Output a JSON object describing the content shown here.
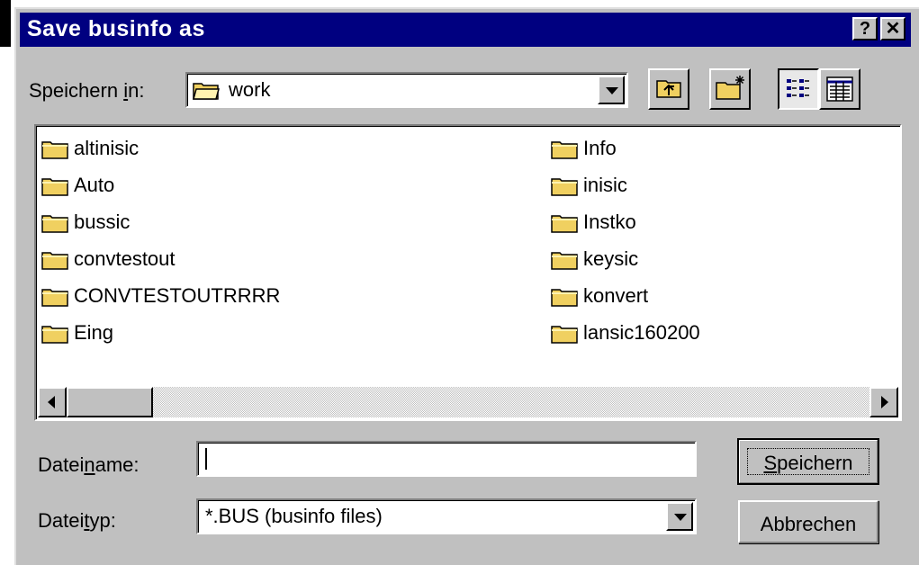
{
  "dialog": {
    "title": "Save businfo as",
    "help_btn": "?",
    "close_btn": "✕"
  },
  "location": {
    "label_pre": "Speichern ",
    "label_key": "i",
    "label_post": "n:",
    "value": "work"
  },
  "toolbar": {
    "icons": [
      "up-one-level-icon",
      "create-new-folder-icon",
      "list-view-icon",
      "details-view-icon"
    ]
  },
  "files": {
    "column1": [
      "altinisic",
      "Auto",
      "bussic",
      "convtestout",
      "CONVTESTOUTRRRR",
      "Eing"
    ],
    "column2": [
      "Info",
      "inisic",
      "Instko",
      "keysic",
      "konvert",
      "lansic160200"
    ]
  },
  "filename": {
    "label_pre": "Datei",
    "label_key": "n",
    "label_post": "ame:",
    "value": ""
  },
  "filetype": {
    "label_pre": "Datei",
    "label_key": "t",
    "label_post": "yp:",
    "value": "*.BUS (businfo files)"
  },
  "buttons": {
    "save_key": "S",
    "save_rest": "peichern",
    "cancel": "Abbrechen"
  },
  "colors": {
    "titlebar": "#000080",
    "face": "#c0c0c0",
    "folder": "#f0d060"
  }
}
